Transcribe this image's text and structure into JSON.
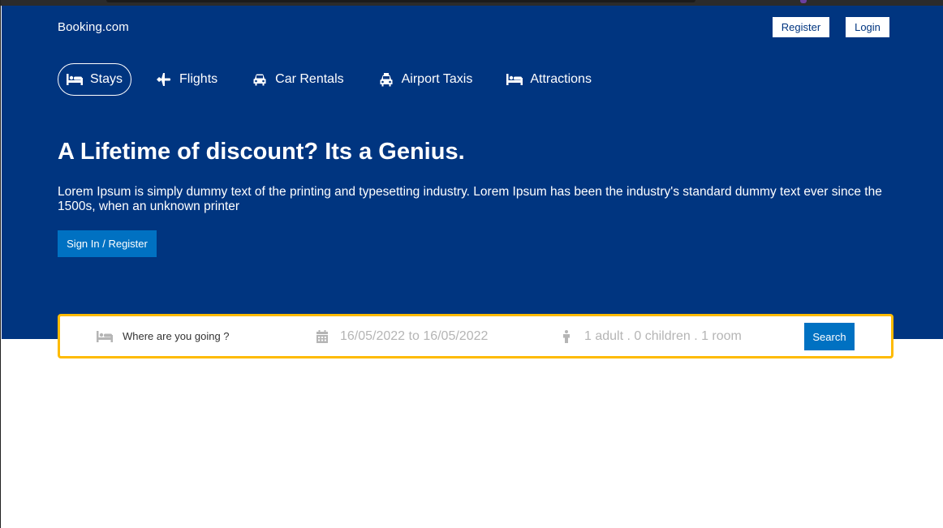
{
  "brand": {
    "logo": "Booking.com",
    "register_label": "Register",
    "login_label": "Login"
  },
  "nav": {
    "items": [
      {
        "label": "Stays",
        "icon": "bed-icon",
        "active": true
      },
      {
        "label": "Flights",
        "icon": "plane-icon",
        "active": false
      },
      {
        "label": "Car Rentals",
        "icon": "car-icon",
        "active": false
      },
      {
        "label": "Airport Taxis",
        "icon": "taxi-icon",
        "active": false
      },
      {
        "label": "Attractions",
        "icon": "bed-icon",
        "active": false
      }
    ]
  },
  "hero": {
    "title": "A Lifetime of discount? Its a Genius.",
    "description": "Lorem Ipsum is simply dummy text of the printing and typesetting industry. Lorem Ipsum has been the industry's standard dummy text ever since the 1500s, when an unknown printer",
    "cta_label": "Sign In / Register"
  },
  "search": {
    "destination_placeholder": "Where are you going ?",
    "dates": "16/05/2022 to 16/05/2022",
    "guests": "1 adult . 0 children . 1 room",
    "button_label": "Search"
  },
  "colors": {
    "header_bg": "#003580",
    "accent_blue": "#0071c2",
    "search_border": "#febb02",
    "muted_text": "#b5b5b5"
  }
}
